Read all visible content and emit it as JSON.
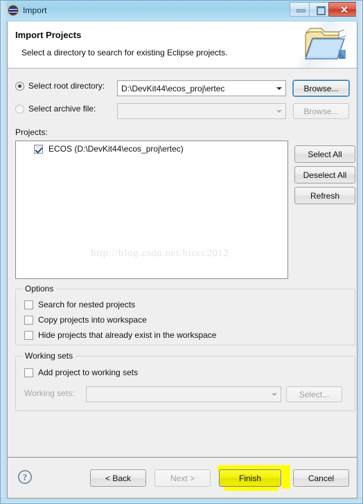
{
  "window": {
    "title": "Import",
    "icon": "eclipse-icon",
    "buttons": {
      "minimize": "minimize-icon",
      "maximize": "maximize-icon",
      "close": "✕"
    }
  },
  "header": {
    "title": "Import Projects",
    "subtitle": "Select a directory to search for existing Eclipse projects.",
    "icon": "open-folder-icon"
  },
  "source": {
    "root_directory": {
      "label": "Select root directory:",
      "selected": true,
      "value": "D:\\DevKit44\\ecos_proj\\ertec",
      "browse_label": "Browse...",
      "browse_enabled": true
    },
    "archive_file": {
      "label": "Select archive file:",
      "selected": false,
      "value": "",
      "browse_label": "Browse...",
      "browse_enabled": false
    }
  },
  "projects": {
    "label": "Projects:",
    "items": [
      {
        "name": "ECOS (D:\\DevKit44\\ecos_proj\\ertec)",
        "checked": true
      }
    ],
    "buttons": {
      "select_all": "Select All",
      "deselect_all": "Deselect All",
      "refresh": "Refresh"
    },
    "watermark": "http://blog.csdn.net/hiccc2012"
  },
  "options": {
    "title": "Options",
    "items": [
      {
        "label": "Search for nested projects",
        "checked": false
      },
      {
        "label": "Copy projects into workspace",
        "checked": false
      },
      {
        "label": "Hide projects that already exist in the workspace",
        "checked": false
      }
    ]
  },
  "working_sets": {
    "title": "Working sets",
    "add_checkbox": {
      "label": "Add project to working sets",
      "checked": false
    },
    "field_label": "Working sets:",
    "field_value": "",
    "select_label": "Select...",
    "enabled": false
  },
  "footer": {
    "help": "help-icon",
    "back": "< Back",
    "next": "Next >",
    "finish": "Finish",
    "cancel": "Cancel",
    "next_enabled": false,
    "finish_highlight_color": "#ffff00"
  }
}
